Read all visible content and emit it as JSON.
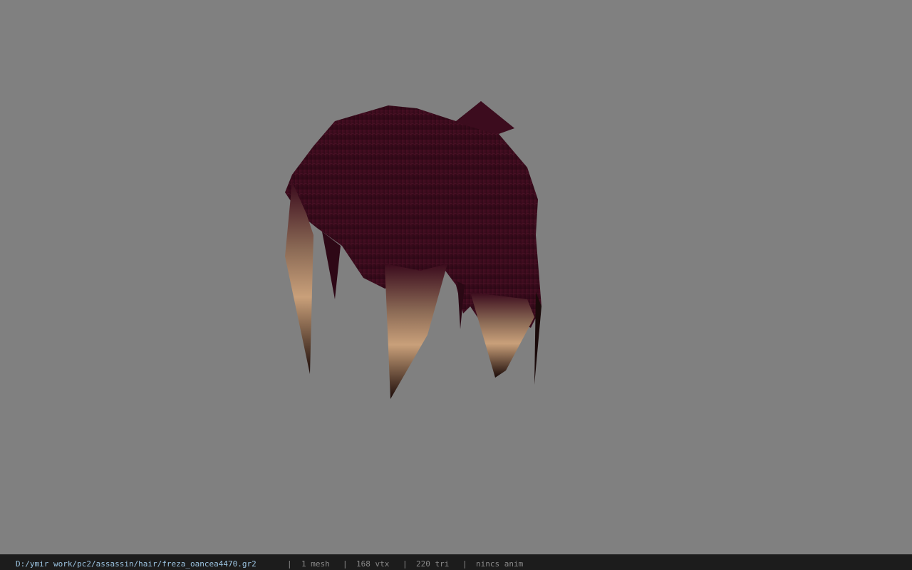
{
  "viewport": {
    "background": "#808080",
    "model_name": "hair-mesh",
    "hair_color": "#3a0a1c",
    "tip_color": "#c9a07a"
  },
  "statusbar": {
    "file_path": "D:/ymir work/pc2/assassin/hair/freza_oancea4470.gr2",
    "separator": "|",
    "mesh_count": "1 mesh",
    "vertex_count": "168 vtx",
    "triangle_count": "220 tri",
    "anim_status": "nincs anim"
  }
}
